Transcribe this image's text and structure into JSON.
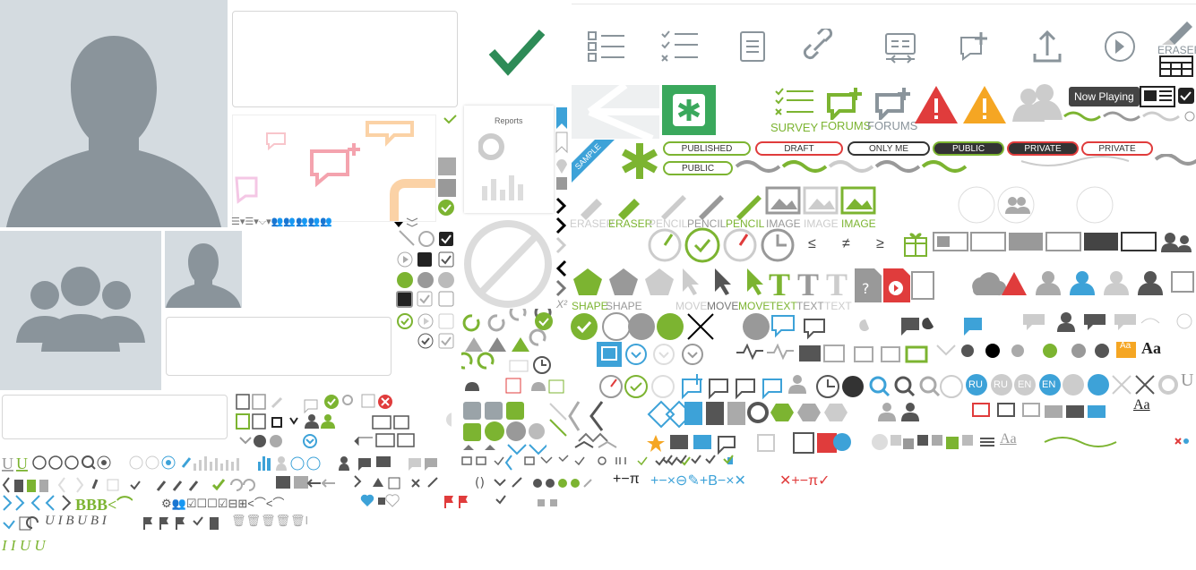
{
  "colors": {
    "green": "#7cb431",
    "grey": "#8a949b",
    "light": "#c9cdd0",
    "red": "#e03c3c",
    "blue": "#3da2d8",
    "dark": "#2d2d2d",
    "orange": "#f5a623"
  },
  "report": {
    "title": "Reports"
  },
  "toolbar_labels": {
    "eraser_top": "ERASER",
    "survey": "SURVEY",
    "forums_green": "FORUMS",
    "forums_grey": "FORUMS",
    "now_playing": "Now Playing",
    "sample": "SAMPLE",
    "eraser_grey": "ERASER",
    "eraser_green": "ERASER",
    "pencil_grey1": "PENCIL",
    "pencil_grey2": "PENCIL",
    "pencil_green": "PENCIL",
    "image_grey1": "IMAGE",
    "image_grey2": "IMAGE",
    "image_green": "IMAGE",
    "shape_green": "SHAPE",
    "shape_grey": "SHAPE",
    "move_grey1": "MOVE",
    "move_grey2": "MOVE",
    "move_green": "MOVE",
    "text_green": "TEXT",
    "text_grey1": "TEXT",
    "text_grey2": "TEXT",
    "lt_eq": "≤",
    "not_eq": "≠",
    "gt_eq": "≥",
    "aa1": "Aa",
    "aa2": "Aa",
    "aa3": "Aa",
    "aa4": "Aa",
    "x2": "X²",
    "bold_b": "B",
    "ru1": "RU",
    "ru2": "RU",
    "en1": "EN",
    "en2": "EN",
    "u_green": "U",
    "u_grey": "U",
    "math_row": "+−π",
    "math_row2": "+−π"
  },
  "pills": [
    {
      "label": "PUBLISHED",
      "style": "green-outline"
    },
    {
      "label": "DRAFT",
      "style": "red-outline"
    },
    {
      "label": "ONLY ME",
      "style": "dark-outline"
    },
    {
      "label": "PUBLIC",
      "style": "green-filled"
    },
    {
      "label": "PRIVATE",
      "style": "dark-filled"
    },
    {
      "label": "PRIVATE",
      "style": "red-outline"
    },
    {
      "label": "PUBLIC",
      "style": "green-outline"
    }
  ],
  "text_rows": {
    "row_a": "☰▾☰▾⌵▾👥👥👥👥👥",
    "row_b": "BBB<⌒",
    "row_c": "U I B U B I",
    "row_d": "I I U U",
    "row_e": "+−×⊖✎+B−×✕",
    "row_f": "✕+−π✓",
    "row_g": "⚙👥☑☐☐☑⊟⊞<⌒<⌒",
    "row_h": "🗑🗑🗑🗑🗑I"
  }
}
